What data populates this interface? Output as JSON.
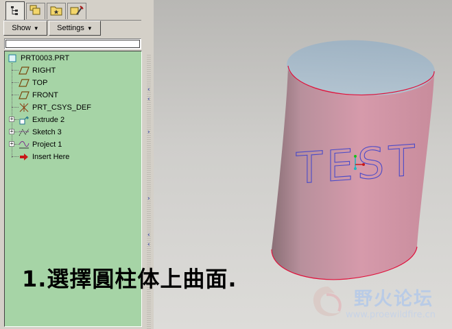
{
  "toolbar": {
    "show_label": "Show",
    "settings_label": "Settings"
  },
  "tabs": [
    {
      "icon": "model-tree-icon",
      "active": true
    },
    {
      "icon": "folder-browser-icon",
      "active": false
    },
    {
      "icon": "favorites-icon",
      "active": false
    },
    {
      "icon": "tools-icon",
      "active": false
    }
  ],
  "tree": {
    "root": "PRT0003.PRT",
    "items": [
      {
        "label": "RIGHT",
        "icon": "datum-plane-icon"
      },
      {
        "label": "TOP",
        "icon": "datum-plane-icon"
      },
      {
        "label": "FRONT",
        "icon": "datum-plane-icon"
      },
      {
        "label": "PRT_CSYS_DEF",
        "icon": "coordinate-system-icon"
      },
      {
        "label": "Extrude 2",
        "icon": "extrude-icon",
        "expandable": true
      },
      {
        "label": "Sketch 3",
        "icon": "sketch-icon",
        "expandable": true
      },
      {
        "label": "Project 1",
        "icon": "project-curve-icon",
        "expandable": true
      },
      {
        "label": "Insert Here",
        "icon": "insert-arrow-icon"
      }
    ]
  },
  "viewport": {
    "projected_text": "TEST",
    "caption": "1.選擇圓柱体上曲面.",
    "watermark_title": "野火论坛",
    "watermark_url": "www.proewildfire.cn"
  },
  "colors": {
    "tree_background": "#a6d4a6",
    "cylinder_side": "#c98f9f",
    "cylinder_top": "#a9bccb",
    "edge_highlight": "#e0103a",
    "projected_text": "#4a4ac8"
  }
}
